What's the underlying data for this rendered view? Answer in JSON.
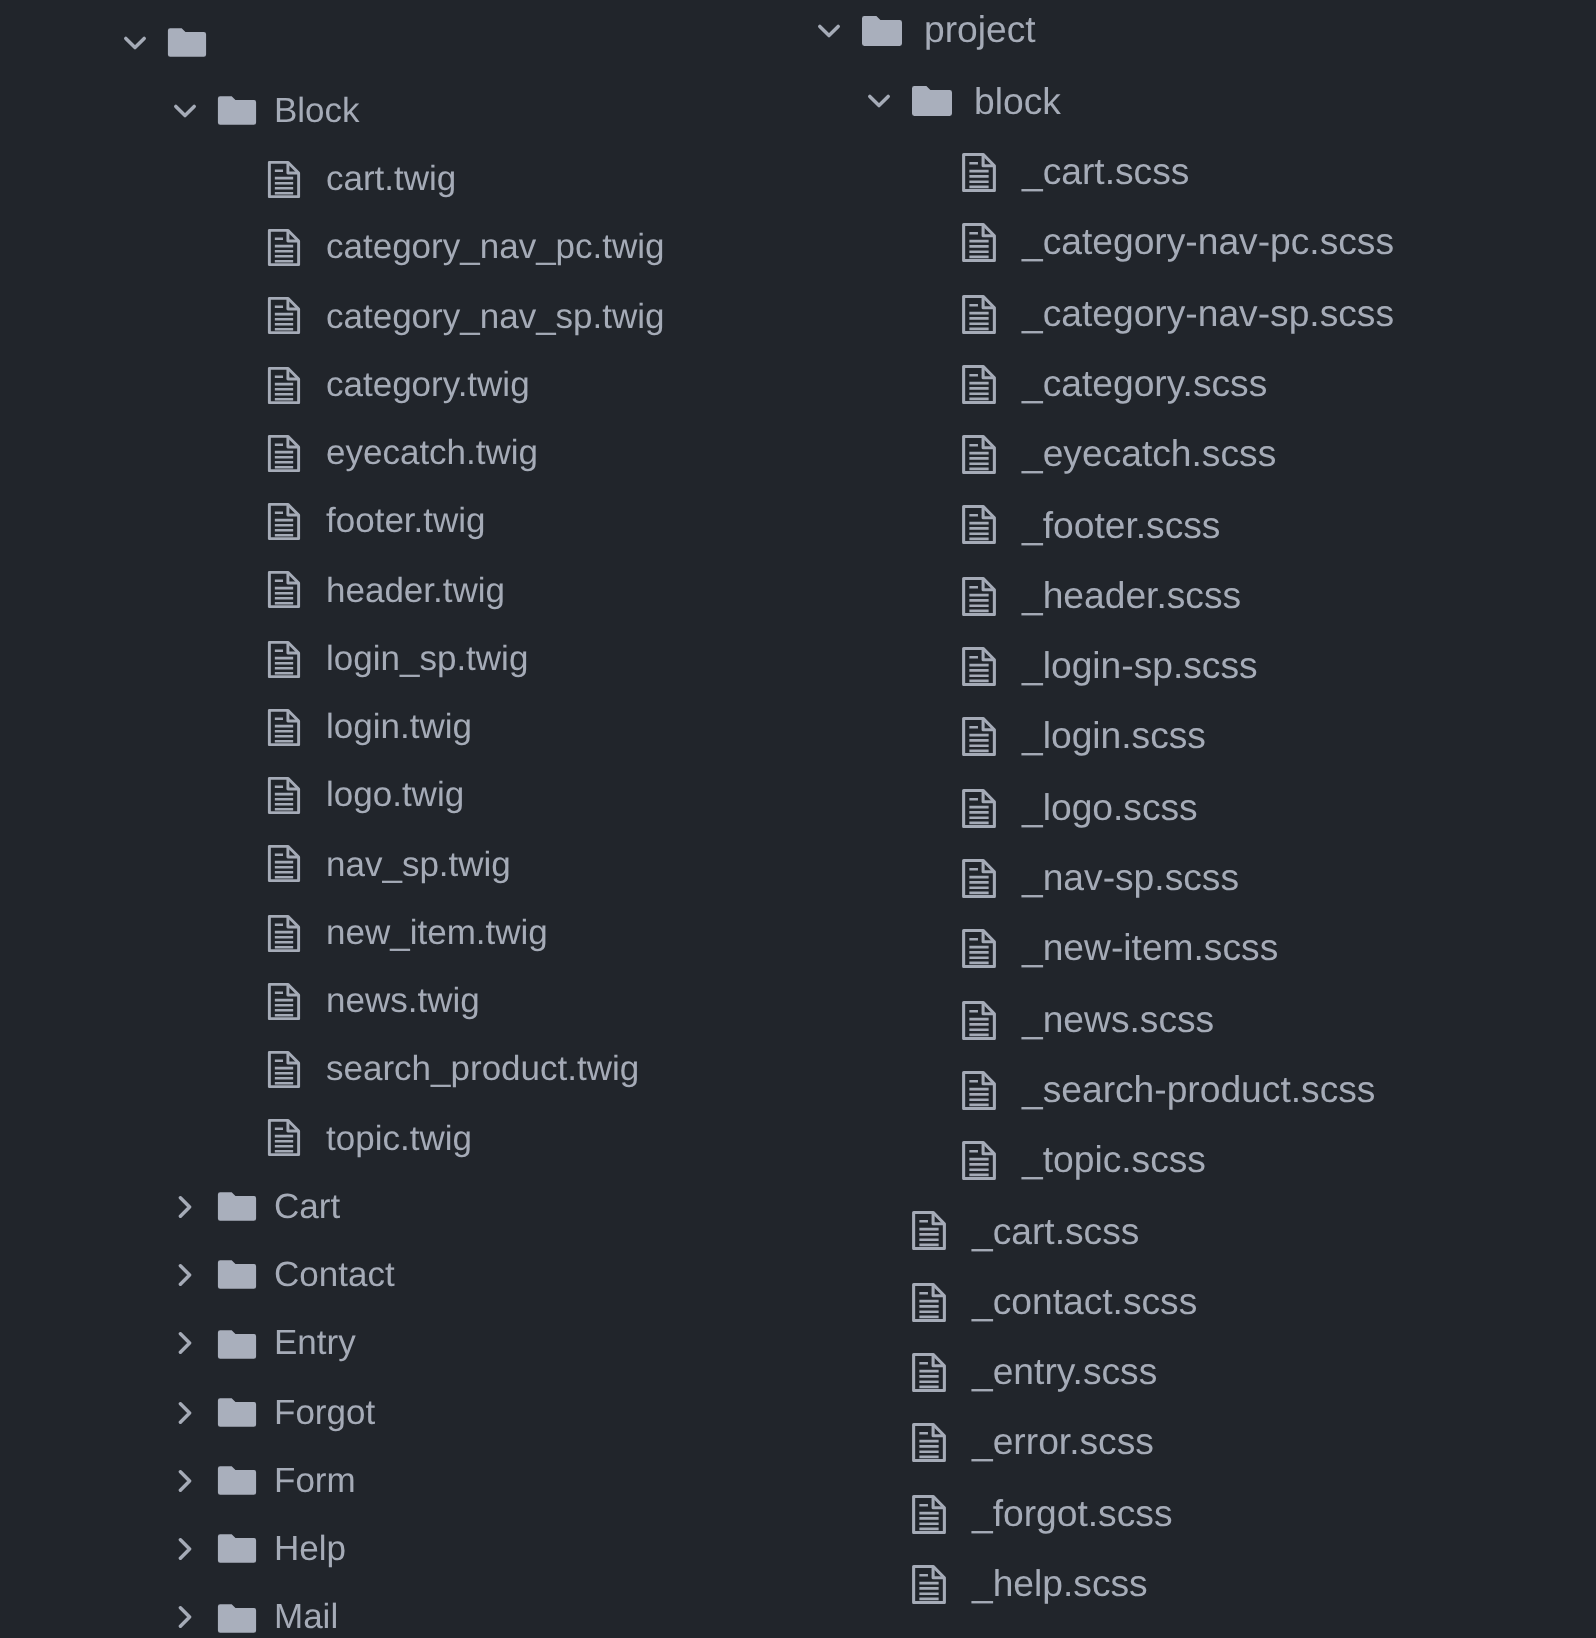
{
  "trees": [
    {
      "items": [
        {
          "kind": "folder",
          "expanded": true,
          "children": [
            {
              "kind": "folder",
              "name": "Block",
              "expanded": true,
              "children": [
                {
                  "kind": "file",
                  "name": "cart.twig"
                },
                {
                  "kind": "file",
                  "name": "category_nav_pc.twig"
                },
                {
                  "kind": "file",
                  "name": "category_nav_sp.twig"
                },
                {
                  "kind": "file",
                  "name": "category.twig"
                },
                {
                  "kind": "file",
                  "name": "eyecatch.twig"
                },
                {
                  "kind": "file",
                  "name": "footer.twig"
                },
                {
                  "kind": "file",
                  "name": "header.twig"
                },
                {
                  "kind": "file",
                  "name": "login_sp.twig"
                },
                {
                  "kind": "file",
                  "name": "login.twig"
                },
                {
                  "kind": "file",
                  "name": "logo.twig"
                },
                {
                  "kind": "file",
                  "name": "nav_sp.twig"
                },
                {
                  "kind": "file",
                  "name": "new_item.twig"
                },
                {
                  "kind": "file",
                  "name": "news.twig"
                },
                {
                  "kind": "file",
                  "name": "search_product.twig"
                },
                {
                  "kind": "file",
                  "name": "topic.twig"
                }
              ]
            },
            {
              "kind": "folder",
              "name": "Cart",
              "expanded": false
            },
            {
              "kind": "folder",
              "name": "Contact",
              "expanded": false
            },
            {
              "kind": "folder",
              "name": "Entry",
              "expanded": false
            },
            {
              "kind": "folder",
              "name": "Forgot",
              "expanded": false
            },
            {
              "kind": "folder",
              "name": "Form",
              "expanded": false
            },
            {
              "kind": "folder",
              "name": "Help",
              "expanded": false
            },
            {
              "kind": "folder",
              "name": "Mail",
              "expanded": false
            }
          ]
        }
      ]
    },
    {
      "items": [
        {
          "kind": "folder",
          "name": "project",
          "expanded": true,
          "children": [
            {
              "kind": "folder",
              "name": "block",
              "expanded": true,
              "children": [
                {
                  "kind": "file",
                  "name": "_cart.scss"
                },
                {
                  "kind": "file",
                  "name": "_category-nav-pc.scss"
                },
                {
                  "kind": "file",
                  "name": "_category-nav-sp.scss"
                },
                {
                  "kind": "file",
                  "name": "_category.scss"
                },
                {
                  "kind": "file",
                  "name": "_eyecatch.scss"
                },
                {
                  "kind": "file",
                  "name": "_footer.scss"
                },
                {
                  "kind": "file",
                  "name": "_header.scss"
                },
                {
                  "kind": "file",
                  "name": "_login-sp.scss"
                },
                {
                  "kind": "file",
                  "name": "_login.scss"
                },
                {
                  "kind": "file",
                  "name": "_logo.scss"
                },
                {
                  "kind": "file",
                  "name": "_nav-sp.scss"
                },
                {
                  "kind": "file",
                  "name": "_new-item.scss"
                },
                {
                  "kind": "file",
                  "name": "_news.scss"
                },
                {
                  "kind": "file",
                  "name": "_search-product.scss"
                },
                {
                  "kind": "file",
                  "name": "_topic.scss"
                }
              ]
            },
            {
              "kind": "file",
              "name": "_cart.scss"
            },
            {
              "kind": "file",
              "name": "_contact.scss"
            },
            {
              "kind": "file",
              "name": "_entry.scss"
            },
            {
              "kind": "file",
              "name": "_error.scss"
            },
            {
              "kind": "file",
              "name": "_forgot.scss"
            },
            {
              "kind": "file",
              "name": "_help.scss"
            }
          ]
        }
      ]
    }
  ]
}
